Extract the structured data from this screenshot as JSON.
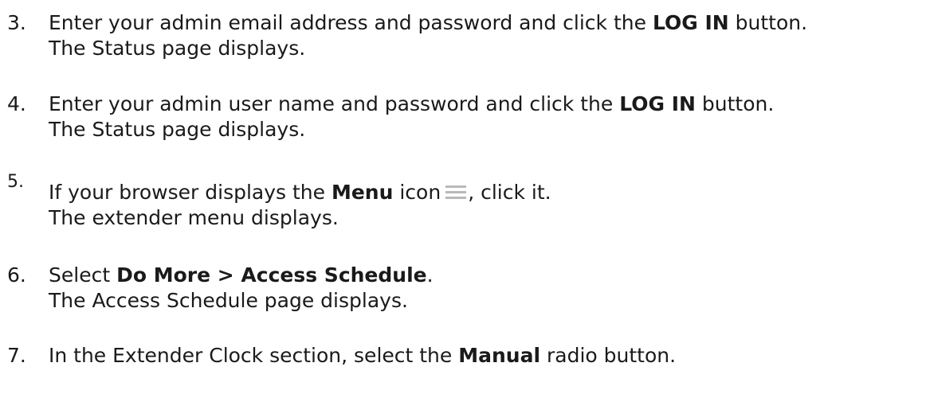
{
  "steps": [
    {
      "number": "3.",
      "line1_a": "Enter your admin email address and password and click the ",
      "line1_bold": "LOG IN",
      "line1_b": " button.",
      "line2": "The Status page displays."
    },
    {
      "number": "4.",
      "line1_a": "Enter your admin user name and password and click the ",
      "line1_bold": "LOG IN",
      "line1_b": " button.",
      "line2": "The Status page displays."
    },
    {
      "number": "5.",
      "line1_a": "If your browser displays the ",
      "line1_bold": "Menu",
      "line1_b": " icon",
      "line1_c": ", click it.",
      "icon": "menu-icon",
      "line2": "The extender menu displays."
    },
    {
      "number": "6.",
      "line1_a": "Select ",
      "line1_bold": "Do More > Access Schedule",
      "line1_b": ".",
      "line2": "The Access Schedule page displays."
    },
    {
      "number": "7.",
      "line1_a": "In the Extender Clock section, select the ",
      "line1_bold": "Manual",
      "line1_b": " radio button."
    }
  ]
}
